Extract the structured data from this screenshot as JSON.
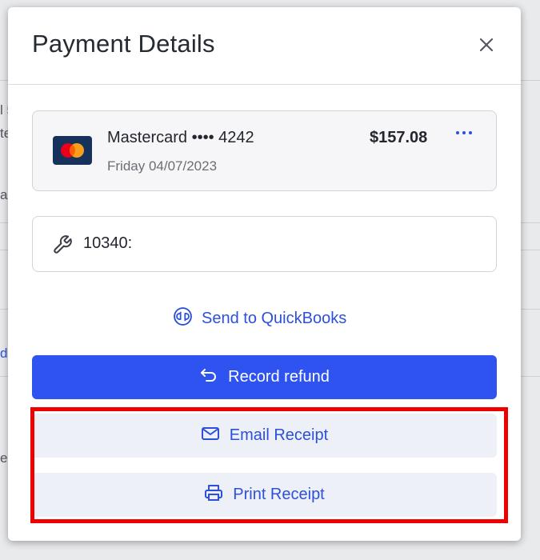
{
  "modal": {
    "title": "Payment Details",
    "close_icon": "close-icon"
  },
  "payment": {
    "brand_icon": "mastercard-icon",
    "card_label": "Mastercard •••• 4242",
    "date": "Friday 04/07/2023",
    "amount": "$157.08",
    "menu_icon": "more-horizontal-icon"
  },
  "memo": {
    "icon": "wrench-icon",
    "text": "10340:"
  },
  "quickbooks": {
    "icon": "quickbooks-icon",
    "label": "Send to QuickBooks"
  },
  "actions": {
    "refund": {
      "icon": "undo-arrow-icon",
      "label": "Record refund"
    },
    "email": {
      "icon": "envelope-icon",
      "label": "Email Receipt"
    },
    "print": {
      "icon": "printer-icon",
      "label": "Print Receipt"
    }
  },
  "background_fragments": [
    "l 5",
    "te",
    "a",
    "d",
    "e"
  ],
  "colors": {
    "primary": "#2f53f1",
    "link": "#2c50d9",
    "secondary_button_bg": "#eef0f8",
    "highlight": "#ee0000",
    "card_bg": "#f6f6f8"
  }
}
